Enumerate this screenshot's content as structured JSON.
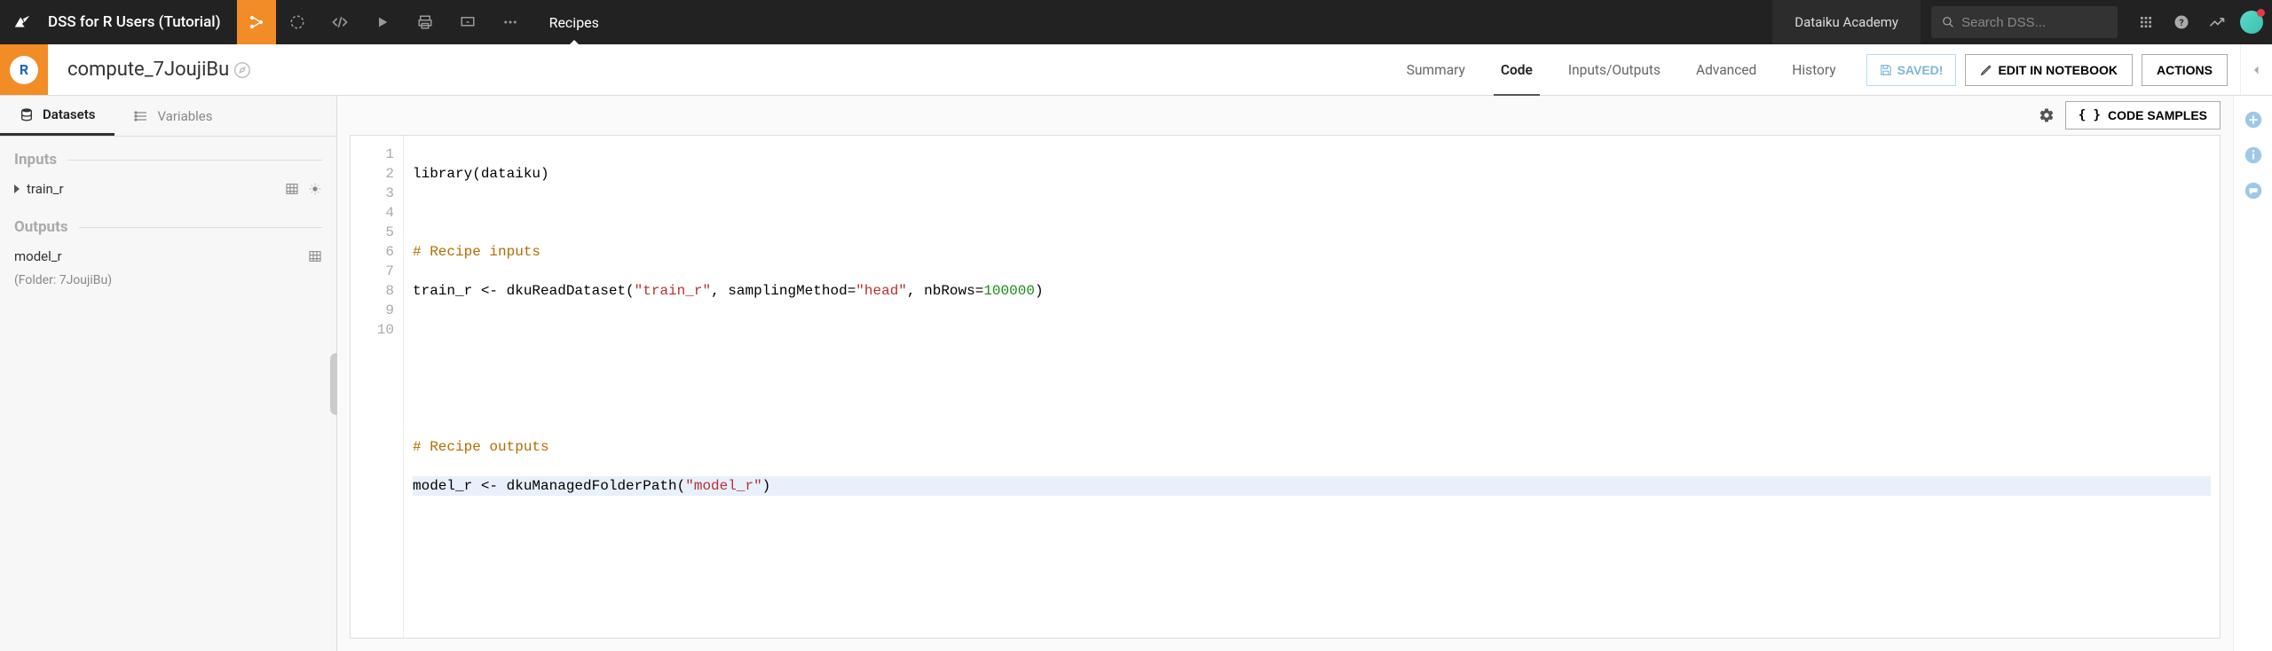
{
  "top": {
    "project_title": "DSS for R Users (Tutorial)",
    "breadcrumb": "Recipes",
    "academy": "Dataiku Academy",
    "search_placeholder": "Search DSS..."
  },
  "recipe": {
    "badge": "R",
    "name": "compute_7JoujiBu",
    "tabs": {
      "summary": "Summary",
      "code": "Code",
      "io": "Inputs/Outputs",
      "advanced": "Advanced",
      "history": "History"
    },
    "saved": "SAVED!",
    "edit_notebook": "EDIT IN NOTEBOOK",
    "actions": "ACTIONS"
  },
  "left_panel": {
    "tab_datasets": "Datasets",
    "tab_variables": "Variables",
    "inputs_title": "Inputs",
    "outputs_title": "Outputs",
    "input_item": "train_r",
    "output_item": "model_r",
    "output_sub": "(Folder: 7JoujiBu)"
  },
  "editor": {
    "code_samples": "CODE SAMPLES",
    "lines": {
      "l1a": "library(dataiku)",
      "l3": "# Recipe inputs",
      "l4a": "train_r <- dkuReadDataset(",
      "l4s1": "\"train_r\"",
      "l4b": ", samplingMethod=",
      "l4s2": "\"head\"",
      "l4c": ", nbRows=",
      "l4n": "100000",
      "l4d": ")",
      "l8": "# Recipe outputs",
      "l9a": "model_r <- dkuManagedFolderPath(",
      "l9s": "\"model_r\"",
      "l9b": ")"
    },
    "linenums": [
      "1",
      "2",
      "3",
      "4",
      "5",
      "6",
      "7",
      "8",
      "9",
      "10"
    ]
  }
}
